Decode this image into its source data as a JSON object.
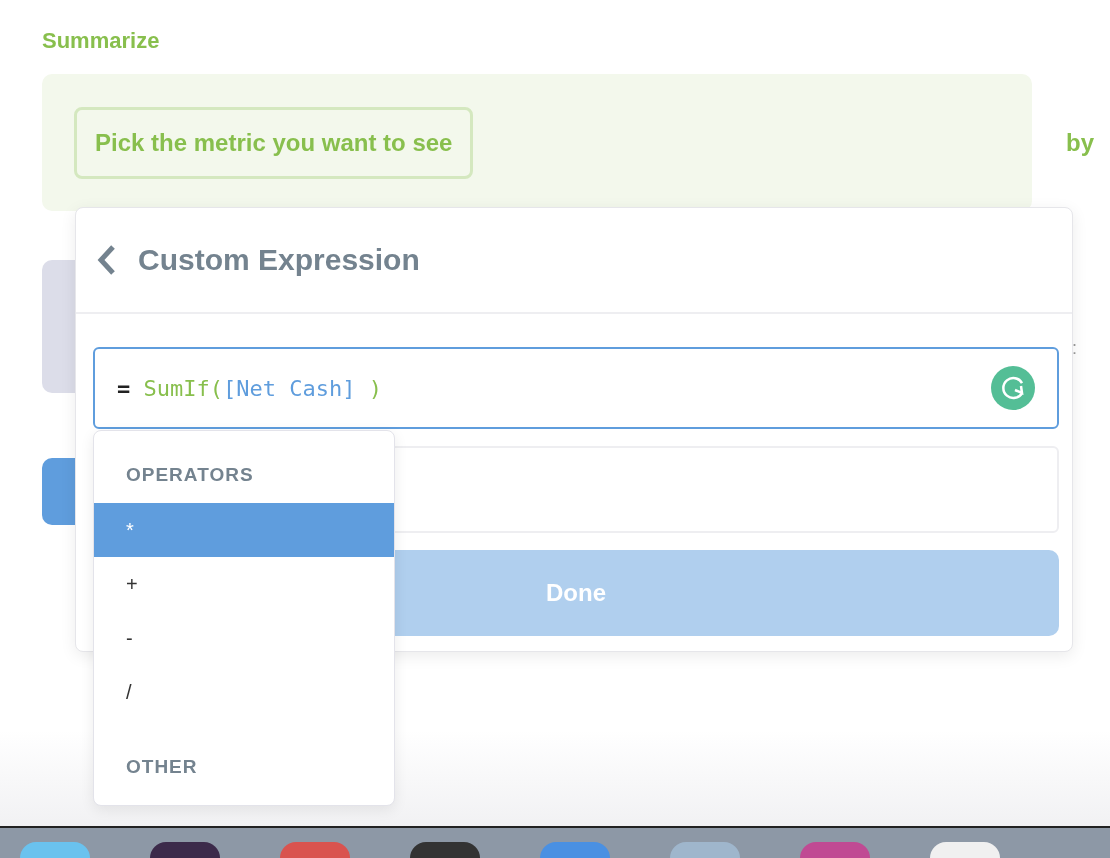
{
  "section_title": "Summarize",
  "metric_picker": {
    "label": "Pick the metric you want to see"
  },
  "by_label": "by",
  "side_mark": ":",
  "popover": {
    "title": "Custom Expression",
    "expression": {
      "prefix": "=",
      "tokens": [
        {
          "kind": "function",
          "text": "SumIf("
        },
        {
          "kind": "field",
          "text": "[Net Cash]"
        },
        {
          "kind": "function",
          "text": " )"
        }
      ]
    },
    "done_button": {
      "label": "Done",
      "disabled": true
    }
  },
  "suggestions": {
    "groups": [
      {
        "heading": "OPERATORS",
        "items": [
          {
            "label": "*",
            "selected": true
          },
          {
            "label": "+",
            "selected": false
          },
          {
            "label": "-",
            "selected": false
          },
          {
            "label": "/",
            "selected": false
          }
        ]
      },
      {
        "heading": "OTHER"
      }
    ]
  }
}
